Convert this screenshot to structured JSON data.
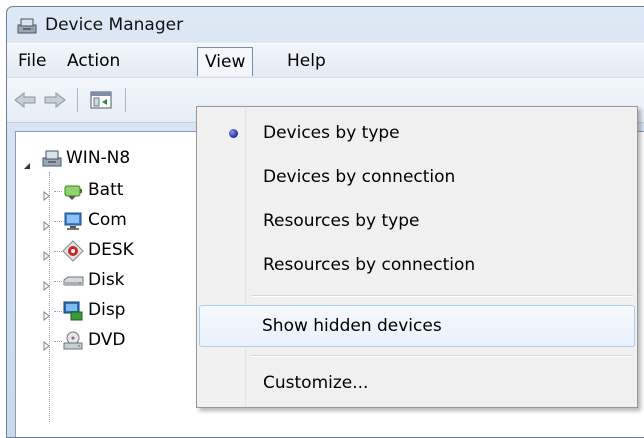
{
  "window": {
    "title": "Device Manager"
  },
  "menubar": {
    "items": [
      {
        "label": "File"
      },
      {
        "label": "Action"
      },
      {
        "label": "View"
      },
      {
        "label": "Help"
      }
    ]
  },
  "tree": {
    "root": "WIN-N8",
    "children": [
      {
        "label": "Batt",
        "icon": "battery-icon"
      },
      {
        "label": "Com",
        "icon": "computer-icon"
      },
      {
        "label": "DESK",
        "icon": "desk-device-icon"
      },
      {
        "label": "Disk",
        "icon": "disk-drive-icon"
      },
      {
        "label": "Disp",
        "icon": "display-adapter-icon"
      },
      {
        "label": "DVD",
        "icon": "dvd-drive-icon"
      }
    ]
  },
  "view_menu": {
    "items": [
      {
        "label": "Devices by type",
        "checked": true
      },
      {
        "label": "Devices by connection",
        "checked": false
      },
      {
        "label": "Resources by type",
        "checked": false
      },
      {
        "label": "Resources by connection",
        "checked": false
      },
      {
        "label": "Show hidden devices",
        "checked": false,
        "highlighted": true
      },
      {
        "label": "Customize...",
        "checked": false
      }
    ]
  },
  "colors": {
    "accent": "#1e2a9c",
    "highlight_border": "#aecbf0",
    "title_bar": "#dde8f5"
  }
}
